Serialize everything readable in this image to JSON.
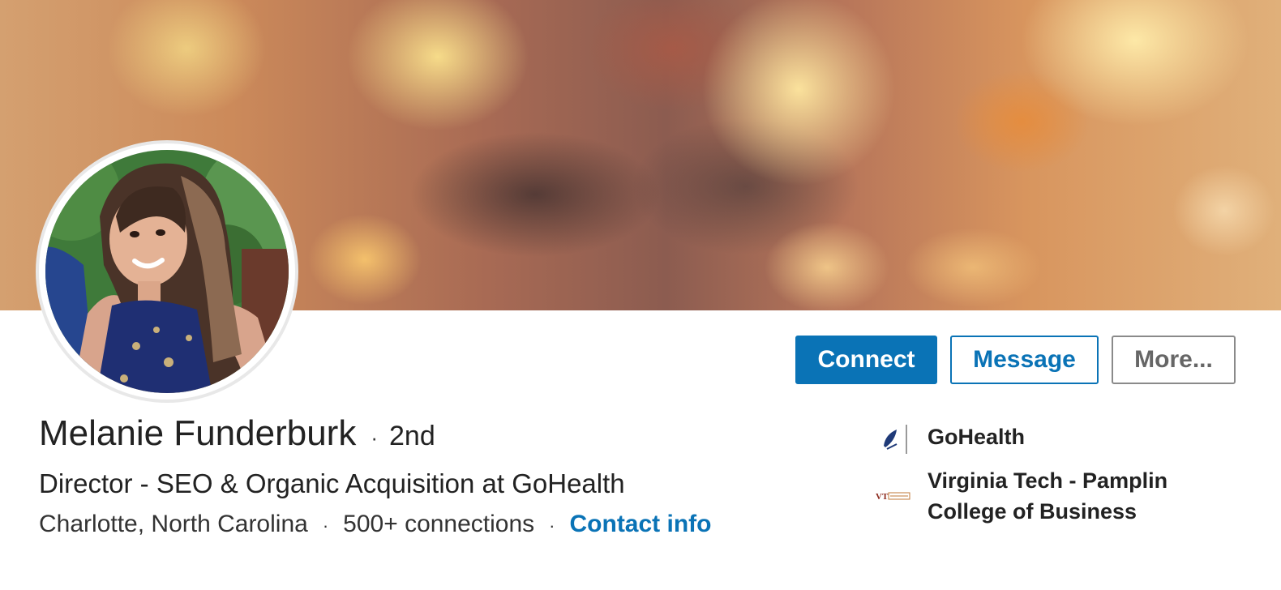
{
  "profile": {
    "name": "Melanie Funderburk",
    "degree": "2nd",
    "separator": "·",
    "headline": "Director - SEO & Organic Acquisition at GoHealth",
    "location": "Charlotte, North Carolina",
    "connections": "500+ connections",
    "contact_info": "Contact info"
  },
  "actions": {
    "connect_label": "Connect",
    "message_label": "Message",
    "more_label": "More..."
  },
  "sidebar": {
    "items": [
      {
        "label": "GoHealth",
        "icon": "gohealth-logo-icon"
      },
      {
        "label": "Virginia Tech - Pamplin College of Business",
        "icon": "virginia-tech-logo-icon"
      }
    ]
  },
  "colors": {
    "accent": "#0a73b6",
    "text": "#222222",
    "more_border": "#8a8a8a"
  }
}
